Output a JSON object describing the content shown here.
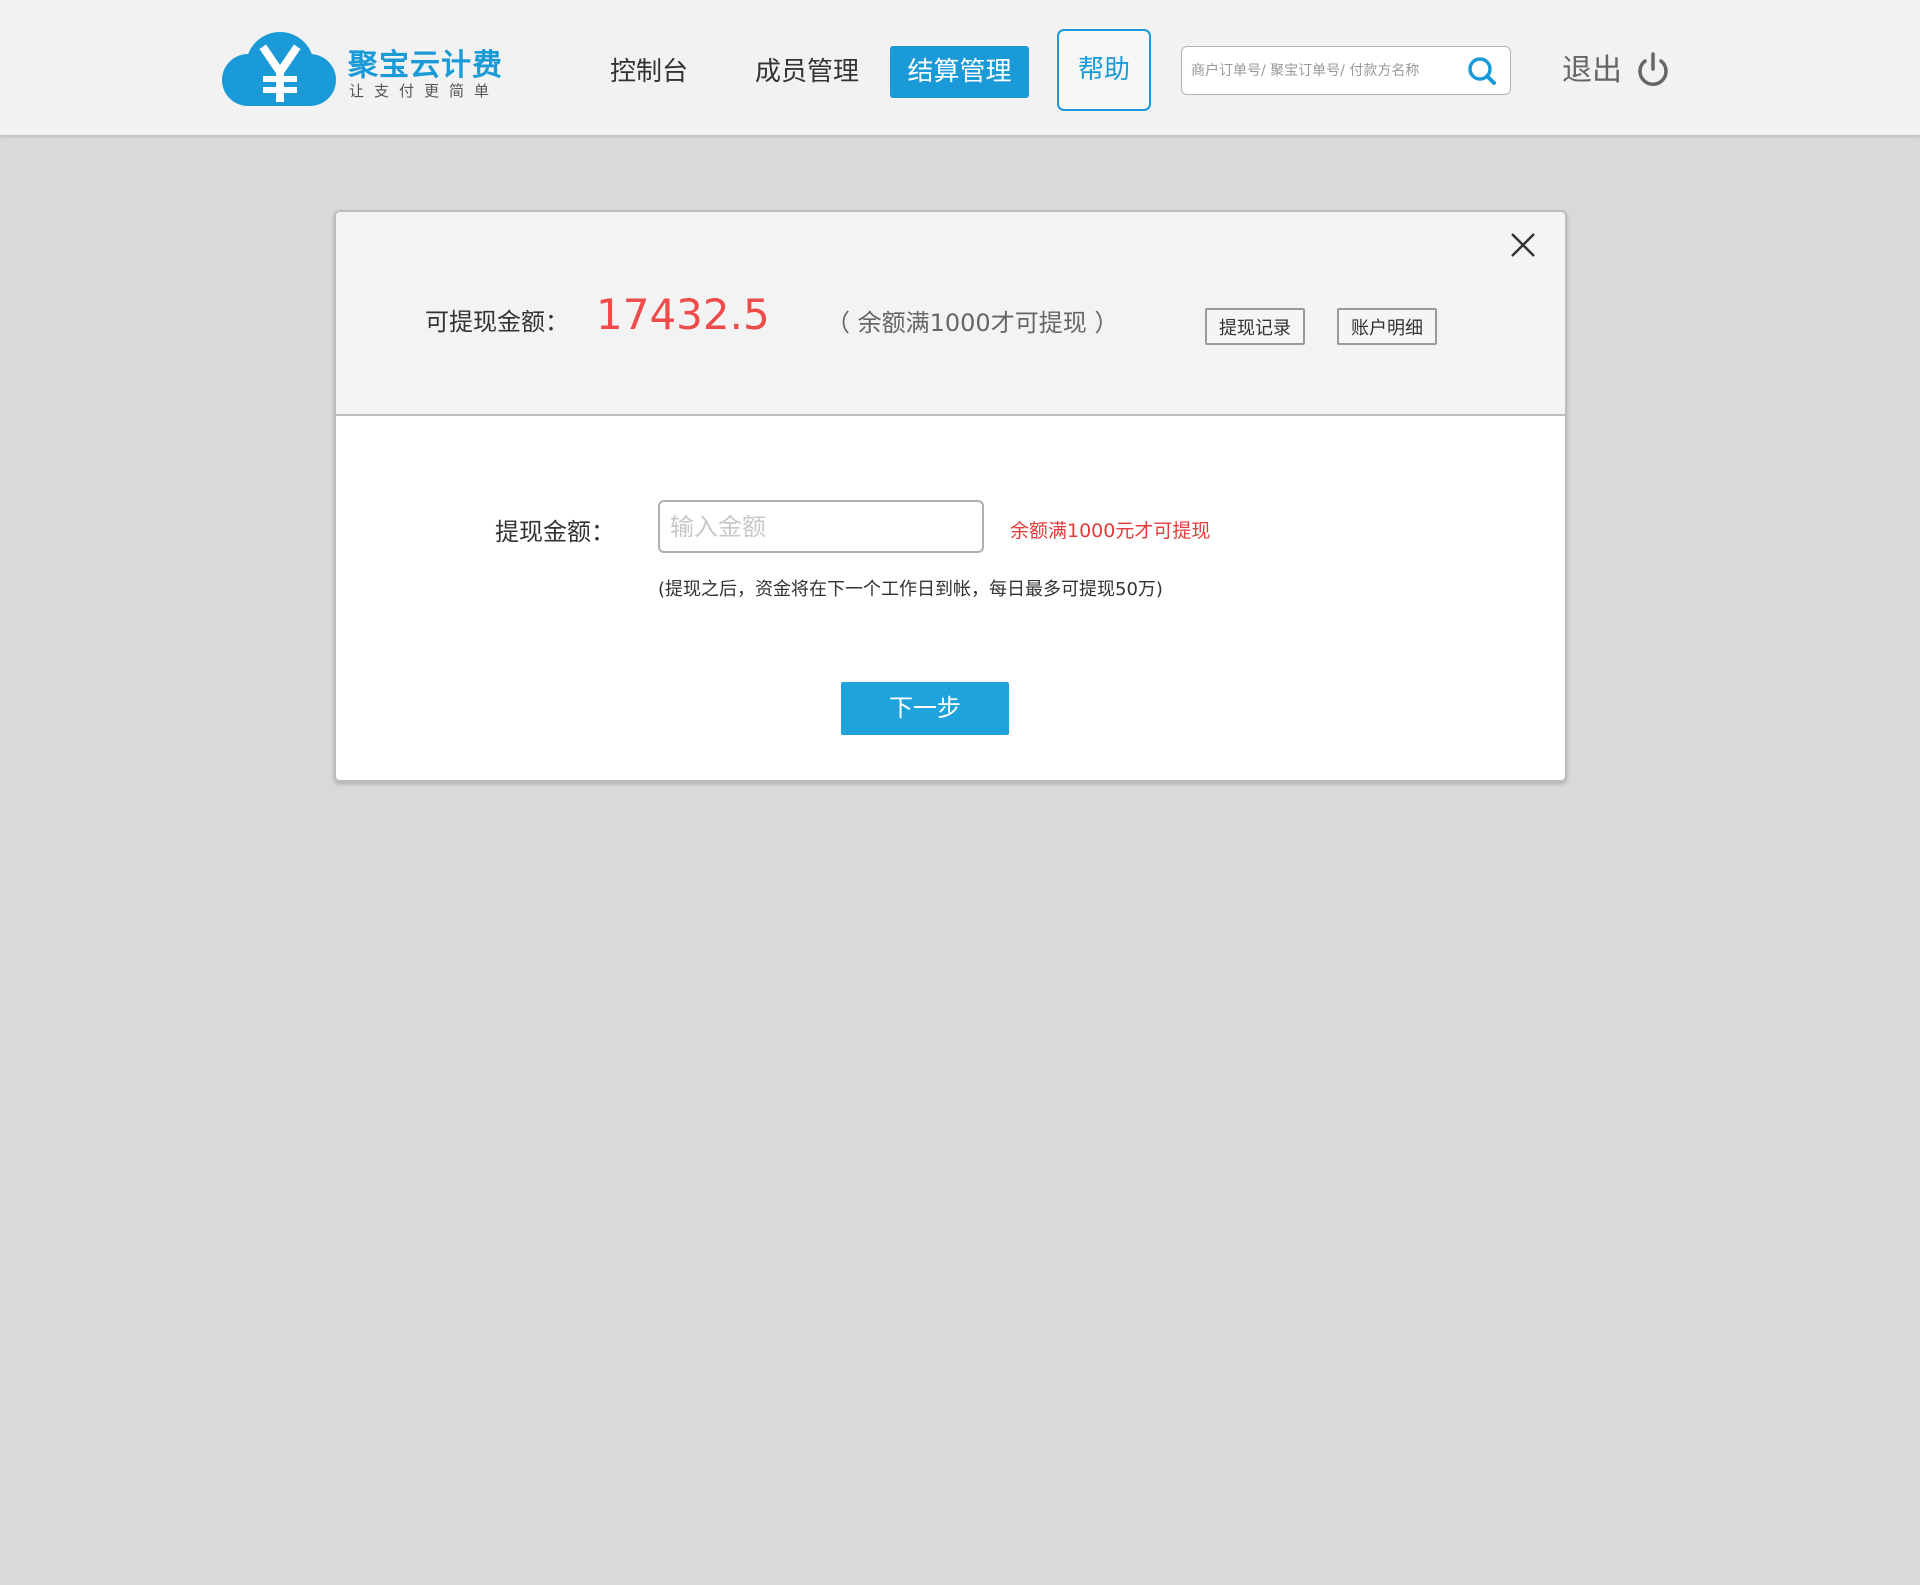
{
  "header": {
    "logo": {
      "name": "聚宝云计费",
      "slogan": "让支付更简单",
      "icon": "cloud-yen-icon",
      "color": "#1a9ad6"
    },
    "nav": {
      "items": [
        {
          "label": "控制台",
          "active": false
        },
        {
          "label": "成员管理",
          "active": false
        },
        {
          "label": "结算管理",
          "active": true
        }
      ],
      "help_label": "帮助"
    },
    "search": {
      "placeholder": "商户订单号/ 聚宝订单号/ 付款方名称",
      "icon": "search-icon"
    },
    "logout": {
      "label": "退出",
      "icon": "power-icon"
    }
  },
  "dialog": {
    "close_icon": "close-icon",
    "available": {
      "label": "可提现金额：",
      "amount": "17432.5",
      "note": "（ 余额满1000才可提现 ）",
      "amount_color": "#ee4b4b"
    },
    "buttons": {
      "records": "提现记录",
      "details": "账户明细"
    },
    "form": {
      "label": "提现金额：",
      "input_value": "",
      "input_placeholder": "输入金额",
      "hint": "余额满1000元才可提现",
      "note": "(提现之后，资金将在下一个工作日到帐，每日最多可提现50万)"
    },
    "next_label": "下一步"
  },
  "colors": {
    "accent": "#1a9ad6",
    "warning": "#e23c3c",
    "background": "#d9d9d9"
  }
}
